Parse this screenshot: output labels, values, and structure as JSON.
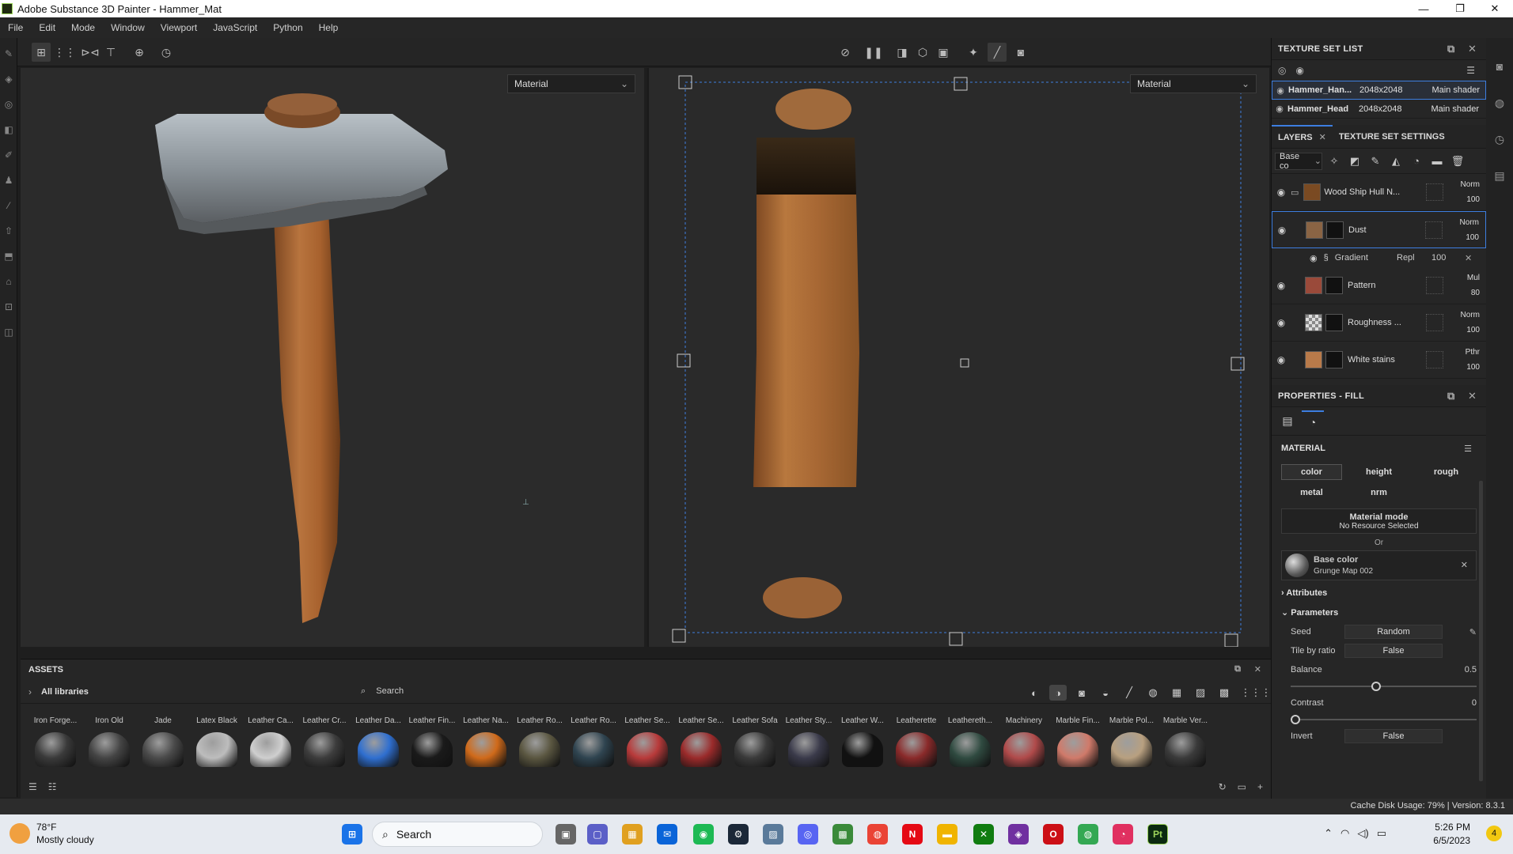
{
  "window": {
    "title": "Adobe Substance 3D Painter - Hammer_Mat",
    "controls": [
      "—",
      "❐",
      "✕"
    ]
  },
  "menu": [
    "File",
    "Edit",
    "Mode",
    "Window",
    "Viewport",
    "JavaScript",
    "Python",
    "Help"
  ],
  "viewport3d": {
    "dropdown": "Material"
  },
  "viewport2d": {
    "dropdown": "Material"
  },
  "texture_set_list": {
    "title": "TEXTURE SET LIST",
    "rows": [
      {
        "name": "Hammer_Han...",
        "res": "2048x2048",
        "shader": "Main shader",
        "selected": true
      },
      {
        "name": "Hammer_Head",
        "res": "2048x2048",
        "shader": "Main shader",
        "selected": false
      }
    ]
  },
  "layers_panel": {
    "tab_layers": "LAYERS",
    "tab_settings": "TEXTURE SET SETTINGS",
    "channel": "Base co",
    "layers": [
      {
        "name": "Wood Ship Hull N...",
        "blend": "Norm",
        "opacity": "100",
        "thumb": "#7a4a22"
      },
      {
        "name": "Dust",
        "blend": "Norm",
        "opacity": "100",
        "thumb": "#8a6444"
      },
      {
        "name": "Pattern",
        "blend": "Mul",
        "opacity": "80",
        "thumb": "#9a4a3a"
      },
      {
        "name": "Roughness ...",
        "blend": "Norm",
        "opacity": "100",
        "thumb": "#b0b0b0"
      },
      {
        "name": "White stains",
        "blend": "Pthr",
        "opacity": "100",
        "thumb": "#b87a4a"
      }
    ],
    "sublayer": {
      "name": "Gradient",
      "blend": "Repl",
      "opacity": "100"
    }
  },
  "properties": {
    "title": "PROPERTIES - FILL",
    "material_label": "MATERIAL",
    "channels": [
      "color",
      "height",
      "rough",
      "metal",
      "nrm"
    ],
    "material_mode": "Material mode",
    "no_resource": "No Resource Selected",
    "or": "Or",
    "base_color_label": "Base color",
    "base_color_resource": "Grunge Map 002",
    "attributes": "Attributes",
    "parameters": "Parameters",
    "seed_label": "Seed",
    "seed_value": "Random",
    "tile_label": "Tile by ratio",
    "tile_value": "False",
    "balance_label": "Balance",
    "balance_value": "0.5",
    "contrast_label": "Contrast",
    "contrast_value": "0",
    "invert_label": "Invert",
    "invert_value": "False"
  },
  "assets": {
    "title": "ASSETS",
    "library": "All libraries",
    "search_placeholder": "Search",
    "items": [
      {
        "label": "Iron Forge...",
        "color": "#3a3a3a"
      },
      {
        "label": "Iron Old",
        "color": "#444444"
      },
      {
        "label": "Jade",
        "color": "#4a4a4a"
      },
      {
        "label": "Latex Black",
        "color": "#bdbdbd"
      },
      {
        "label": "Leather Ca...",
        "color": "#cfcfcf"
      },
      {
        "label": "Leather Cr...",
        "color": "#3c3c3c"
      },
      {
        "label": "Leather Da...",
        "color": "#2f6fd0"
      },
      {
        "label": "Leather Fin...",
        "color": "#1a1a1a"
      },
      {
        "label": "Leather Na...",
        "color": "#d06a1a"
      },
      {
        "label": "Leather Ro...",
        "color": "#5a5640"
      },
      {
        "label": "Leather Ro...",
        "color": "#2f4450"
      },
      {
        "label": "Leather Se...",
        "color": "#b83a3a"
      },
      {
        "label": "Leather Se...",
        "color": "#9a2a2a"
      },
      {
        "label": "Leather Sofa",
        "color": "#3a3a3a"
      },
      {
        "label": "Leather Sty...",
        "color": "#3a3a4a"
      },
      {
        "label": "Leather W...",
        "color": "#111111"
      },
      {
        "label": "Leatherette",
        "color": "#8a2a2a"
      },
      {
        "label": "Leathereth...",
        "color": "#2f4a40"
      },
      {
        "label": "Machinery",
        "color": "#b04a4a"
      },
      {
        "label": "Marble Fin...",
        "color": "#d07a6a"
      },
      {
        "label": "Marble Pol...",
        "color": "#b8a080"
      },
      {
        "label": "Marble Ver...",
        "color": "#3a3a3a"
      }
    ]
  },
  "status": {
    "text": "Cache Disk Usage:  79% | Version: 8.3.1"
  },
  "taskbar": {
    "weather_temp": "78°F",
    "weather_desc": "Mostly cloudy",
    "search": "Search",
    "time": "5:26 PM",
    "date": "6/5/2023",
    "notif_count": "4"
  }
}
